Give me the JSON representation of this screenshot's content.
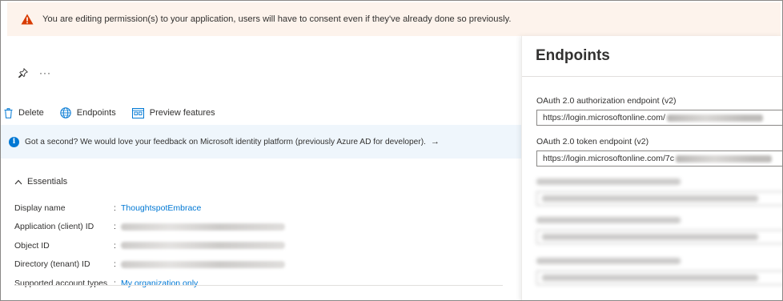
{
  "warning": {
    "text": "You are editing permission(s) to your application, users will have to consent even if they've already done so previously.",
    "icon": "warning-icon",
    "color": "#d83b01"
  },
  "toolbar": {
    "more_label": "···",
    "commands": [
      {
        "label": "Delete",
        "icon": "trash-icon"
      },
      {
        "label": "Endpoints",
        "icon": "globe-icon"
      },
      {
        "label": "Preview features",
        "icon": "preview-icon"
      }
    ]
  },
  "feedback": {
    "text": "Got a second? We would love your feedback on Microsoft identity platform (previously Azure AD for developer).",
    "arrow": "→"
  },
  "essentials": {
    "label": "Essentials",
    "rows": [
      {
        "key": "Display name",
        "value": "ThoughtspotEmbrace",
        "type": "link"
      },
      {
        "key": "Application (client) ID",
        "value": null,
        "type": "blurred"
      },
      {
        "key": "Object ID",
        "value": null,
        "type": "blurred"
      },
      {
        "key": "Directory (tenant) ID",
        "value": null,
        "type": "blurred"
      },
      {
        "key": "Supported account types",
        "value": "My organization only",
        "type": "link"
      }
    ],
    "colon": ":"
  },
  "endpoints": {
    "title": "Endpoints",
    "items": [
      {
        "label": "OAuth 2.0 authorization endpoint (v2)",
        "value": "https://login.microsoftonline.com/"
      },
      {
        "label": "OAuth 2.0 token endpoint (v2)",
        "value": "https://login.microsoftonline.com/7c"
      }
    ]
  },
  "colors": {
    "accent": "#0078d4",
    "warning_bg": "#fdf3ec",
    "info_bg": "#eff6fc"
  }
}
